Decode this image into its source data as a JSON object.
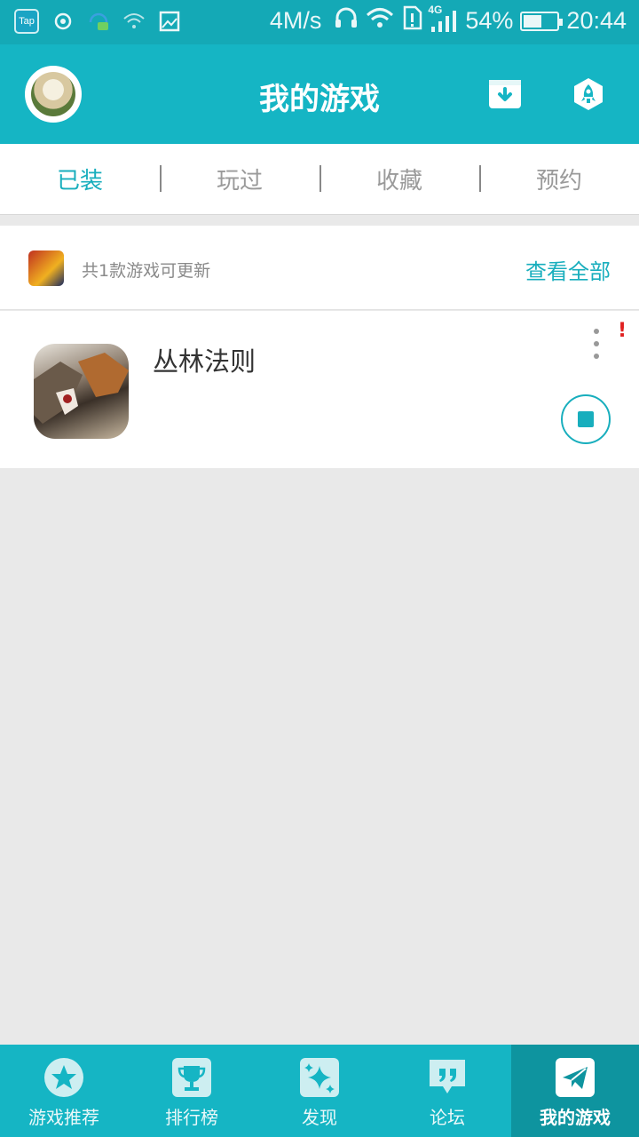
{
  "status_bar": {
    "tap_label": "Tap",
    "speed": "4M/s",
    "network": "4G",
    "battery": "54%",
    "battery_level": 0.54,
    "time": "20:44"
  },
  "header": {
    "title": "我的游戏"
  },
  "tabs": [
    {
      "label": "已装",
      "active": true
    },
    {
      "label": "玩过",
      "active": false
    },
    {
      "label": "收藏",
      "active": false
    },
    {
      "label": "预约",
      "active": false
    }
  ],
  "update_bar": {
    "text": "共1款游戏可更新",
    "link": "查看全部"
  },
  "game": {
    "name": "丛林法则",
    "alert": "!"
  },
  "bottom_nav": [
    {
      "label": "游戏推荐",
      "icon": "star-icon",
      "active": false
    },
    {
      "label": "排行榜",
      "icon": "trophy-icon",
      "active": false
    },
    {
      "label": "发现",
      "icon": "sparkle-icon",
      "active": false
    },
    {
      "label": "论坛",
      "icon": "forum-icon",
      "active": false
    },
    {
      "label": "我的游戏",
      "icon": "send-icon",
      "active": true
    }
  ],
  "colors": {
    "primary": "#15b5c4",
    "accent_text": "#18aebd",
    "nav_active": "#0e949f",
    "alert": "#e02020"
  }
}
